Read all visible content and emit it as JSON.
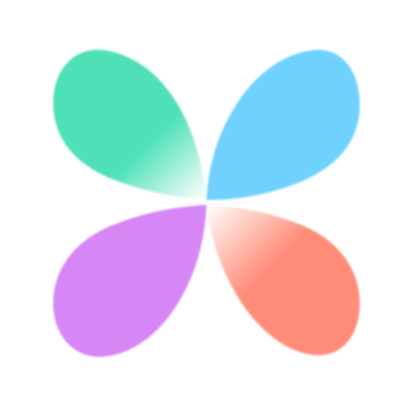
{
  "logo": {
    "name": "four-petal-logo",
    "colors": {
      "top_left": "#4FE0B8",
      "top_right": "#6FD1FF",
      "bottom_left": "#D686F5",
      "bottom_right": "#FF8C78",
      "background": "#FFFFFF"
    }
  }
}
